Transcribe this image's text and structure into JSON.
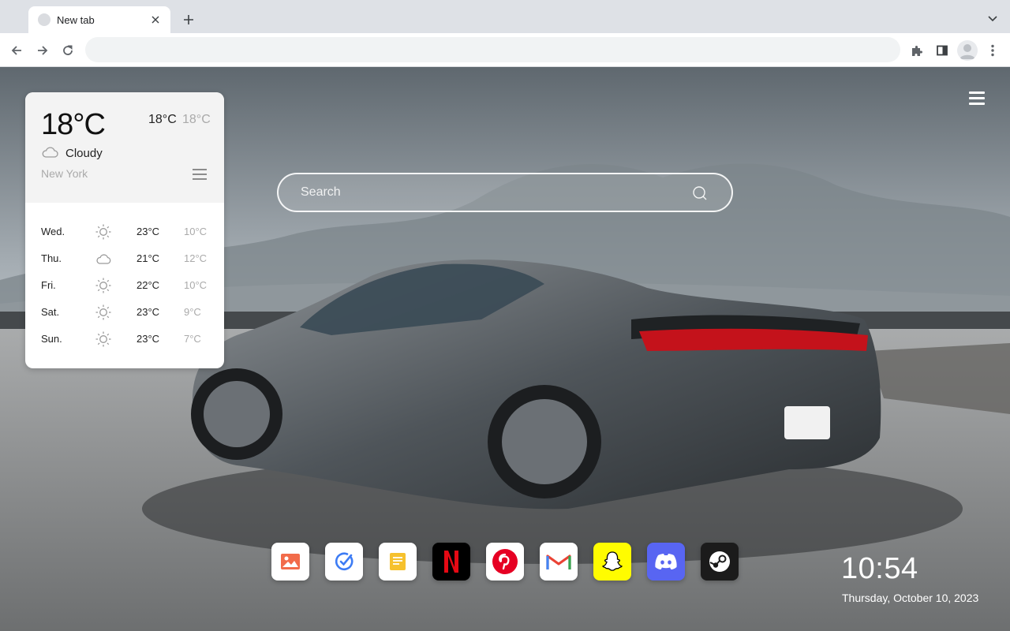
{
  "browser": {
    "tab": {
      "title": "New tab",
      "favicon": "blank-globe-icon"
    },
    "omnibox": {
      "value": "",
      "placeholder": ""
    }
  },
  "colors": {
    "tabstrip": "#dee1e6",
    "sky": "#b9c0c6",
    "road": "#8a8c8e",
    "card": "#ffffff",
    "netflix": "#e50914",
    "pinterest": "#e60023",
    "snapchat": "#fffc00",
    "discord": "#5865f2",
    "steam": "#1b1b1b"
  },
  "weather": {
    "current_temp": "18°C",
    "today_high": "18°C",
    "today_low": "18°C",
    "condition": "Cloudy",
    "condition_icon": "cloud-icon",
    "city": "New York",
    "forecast": [
      {
        "day": "Wed.",
        "icon": "sun-icon",
        "high": "23°C",
        "low": "10°C"
      },
      {
        "day": "Thu.",
        "icon": "cloud-icon",
        "high": "21°C",
        "low": "12°C"
      },
      {
        "day": "Fri.",
        "icon": "sun-icon",
        "high": "22°C",
        "low": "10°C"
      },
      {
        "day": "Sat.",
        "icon": "sun-icon",
        "high": "23°C",
        "low": "9°C"
      },
      {
        "day": "Sun.",
        "icon": "sun-icon",
        "high": "23°C",
        "low": "7°C"
      }
    ]
  },
  "search": {
    "placeholder": "Search"
  },
  "dock": [
    {
      "name": "gallery",
      "icon": "image-gallery-icon"
    },
    {
      "name": "tasks",
      "icon": "checkmark-circle-icon"
    },
    {
      "name": "notes",
      "icon": "notes-icon"
    },
    {
      "name": "netflix",
      "icon": "netflix-icon"
    },
    {
      "name": "pinterest",
      "icon": "pinterest-icon"
    },
    {
      "name": "gmail",
      "icon": "gmail-icon"
    },
    {
      "name": "snapchat",
      "icon": "snapchat-icon"
    },
    {
      "name": "discord",
      "icon": "discord-icon"
    },
    {
      "name": "steam",
      "icon": "steam-icon"
    }
  ],
  "clock": {
    "time": "10:54",
    "date": "Thursday, October 10, 2023"
  }
}
